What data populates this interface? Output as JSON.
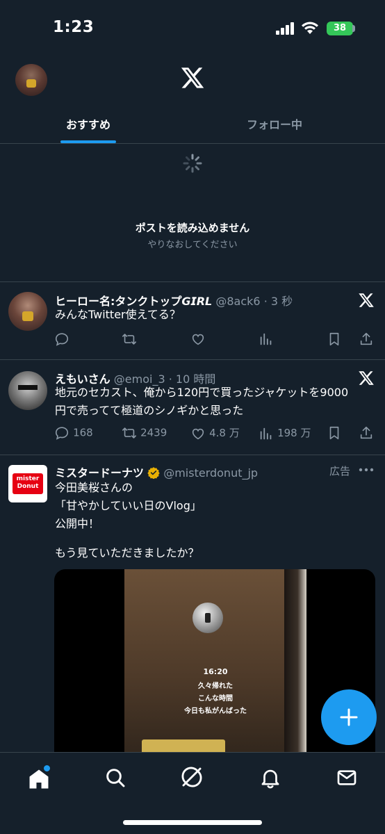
{
  "status": {
    "time": "1:23",
    "battery": "38"
  },
  "header": {
    "tabs": [
      {
        "label": "おすすめ",
        "active": true
      },
      {
        "label": "フォロー中",
        "active": false
      }
    ]
  },
  "error": {
    "title": "ポストを読み込めません",
    "subtitle": "やりなおしてください"
  },
  "posts": [
    {
      "name": "ヒーロー名:タンクトップ𝙂𝙄𝙍𝙇",
      "handle": "@8ack6",
      "time": "3 秒",
      "text": "みんなTwitter使えてる？",
      "replies": "",
      "reposts": "",
      "likes": "",
      "views": ""
    },
    {
      "name": "えもいさん",
      "handle": "@emoi_3",
      "time": "10 時間",
      "text_line1": "地元のセカスト、俺から120円で買ったジャケットを9000",
      "text_line2": "円で売ってて極道のシノギかと思った",
      "replies": "168",
      "reposts": "2439",
      "likes": "4.8 万",
      "views": "198 万"
    },
    {
      "name": "ミスタードーナツ",
      "handle": "@misterdonut_jp",
      "ad_label": "広告",
      "avatar_text": "mister Donut",
      "lines": [
        "今田美桜さんの",
        "「甘やかしていい日のVlog」",
        "公開中！",
        "",
        "もう見ていただきましたか？"
      ],
      "video_captions": [
        "16:20",
        "久々帰れた",
        "こんな時間",
        "今日も私がんばった"
      ]
    }
  ],
  "colors": {
    "background": "#15202b",
    "accent": "#1d9bf0",
    "secondary_text": "#8b98a5",
    "divider": "#38444d",
    "verified": "#e8b004"
  },
  "icons": [
    "signal-icon",
    "wifi-icon",
    "x-logo-icon",
    "spinner-icon",
    "reply-icon",
    "repost-icon",
    "like-icon",
    "views-icon",
    "bookmark-icon",
    "share-icon",
    "more-icon",
    "compose-icon",
    "home-icon",
    "search-icon",
    "grok-icon",
    "notifications-icon",
    "messages-icon"
  ]
}
